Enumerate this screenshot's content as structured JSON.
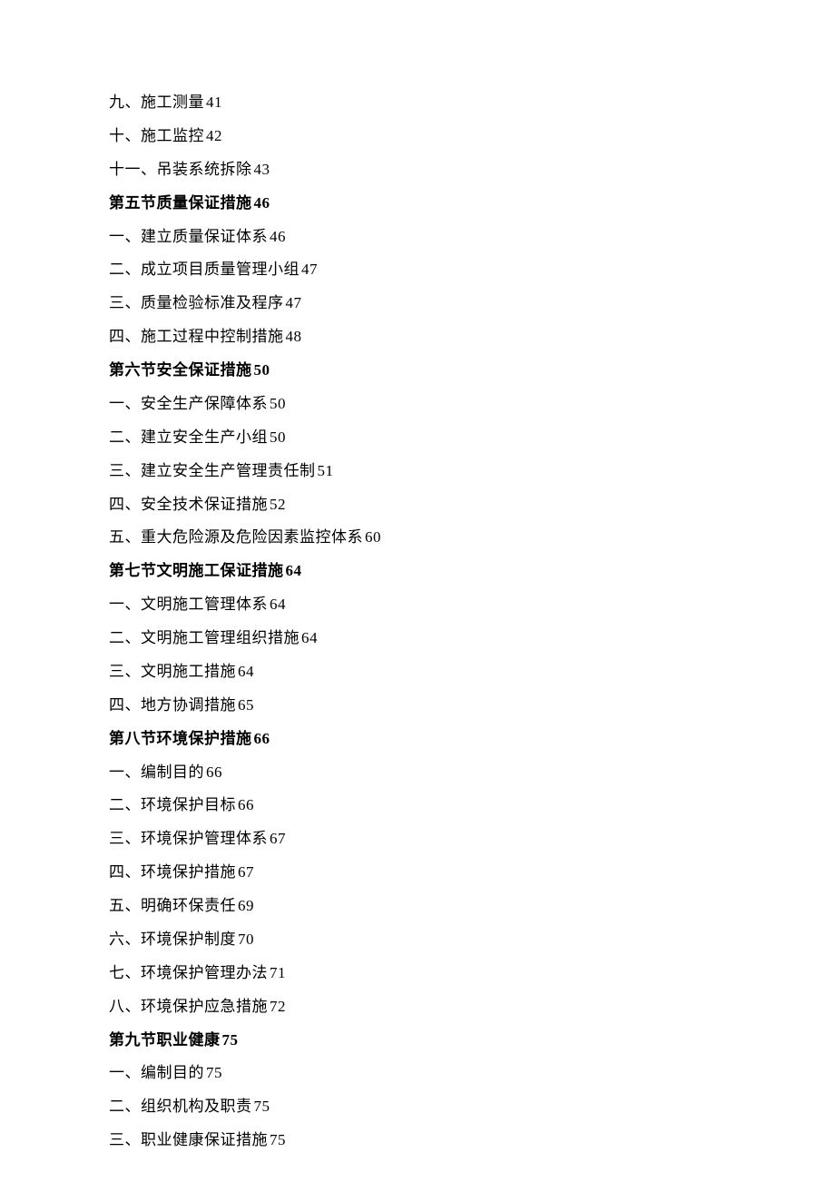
{
  "toc": {
    "pre_items": [
      {
        "text": "九、施工测量",
        "page": "41"
      },
      {
        "text": "十、施工监控",
        "page": "42"
      },
      {
        "text": "十一、吊装系统拆除",
        "page": "43"
      }
    ],
    "sections": [
      {
        "label": "第五节质量保证措施",
        "page": "46",
        "items": [
          {
            "text": "一、建立质量保证体系",
            "page": "46"
          },
          {
            "text": "二、成立项目质量管理小组",
            "page": "47"
          },
          {
            "text": "三、质量检验标准及程序",
            "page": "47"
          },
          {
            "text": "四、施工过程中控制措施",
            "page": "48"
          }
        ]
      },
      {
        "label": "第六节安全保证措施",
        "page": "50",
        "items": [
          {
            "text": "一、安全生产保障体系",
            "page": "50"
          },
          {
            "text": "二、建立安全生产小组",
            "page": "50"
          },
          {
            "text": "三、建立安全生产管理责任制",
            "page": "51"
          },
          {
            "text": "四、安全技术保证措施",
            "page": "52"
          },
          {
            "text": "五、重大危险源及危险因素监控体系",
            "page": "60"
          }
        ]
      },
      {
        "label": "第七节文明施工保证措施",
        "page": "64",
        "items": [
          {
            "text": "一、文明施工管理体系",
            "page": "64"
          },
          {
            "text": "二、文明施工管理组织措施",
            "page": "64"
          },
          {
            "text": "三、文明施工措施",
            "page": "64"
          },
          {
            "text": "四、地方协调措施",
            "page": "65"
          }
        ]
      },
      {
        "label": "第八节环境保护措施",
        "page": "66",
        "items": [
          {
            "text": "一、编制目的",
            "page": "66"
          },
          {
            "text": "二、环境保护目标",
            "page": "66"
          },
          {
            "text": "三、环境保护管理体系",
            "page": "67"
          },
          {
            "text": "四、环境保护措施",
            "page": "67"
          },
          {
            "text": "五、明确环保责任",
            "page": "69"
          },
          {
            "text": "六、环境保护制度",
            "page": "70"
          },
          {
            "text": "七、环境保护管理办法",
            "page": "71"
          },
          {
            "text": "八、环境保护应急措施",
            "page": "72"
          }
        ]
      },
      {
        "label": "第九节职业健康",
        "page": "75",
        "items": [
          {
            "text": "一、编制目的",
            "page": "75"
          },
          {
            "text": "二、组织机构及职责",
            "page": "75"
          },
          {
            "text": "三、职业健康保证措施",
            "page": "75"
          }
        ]
      }
    ]
  }
}
